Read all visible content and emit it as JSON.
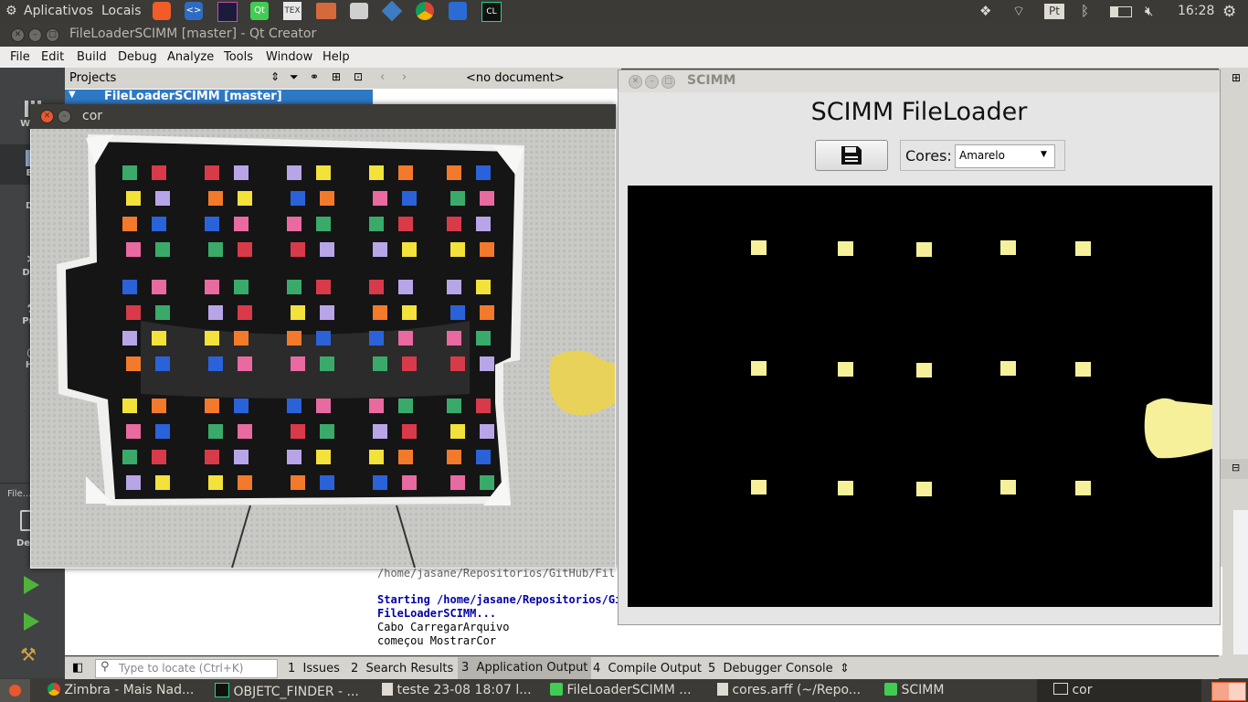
{
  "top_panel": {
    "apps_label": "Aplicativos",
    "places_label": "Locais",
    "keyboard_layout": "Pt",
    "clock": "16:28",
    "launchers": [
      "brave-icon",
      "code-editor-icon",
      "intellij-icon",
      "qt-icon",
      "tex-icon",
      "files-icon",
      "camera-icon",
      "virtualbox-icon",
      "chrome-icon",
      "network-tool-icon",
      "clion-icon"
    ]
  },
  "qt_window": {
    "title": "FileLoaderSCIMM [master] - Qt Creator",
    "menus": [
      "File",
      "Edit",
      "Build",
      "Debug",
      "Analyze",
      "Tools",
      "Window",
      "Help"
    ],
    "projects_label": "Projects",
    "project_root": "FileLoaderSCIMM [master]",
    "no_document": "<no document>",
    "modes": [
      "Welc",
      "Ed",
      "De",
      "Deb",
      "Proj",
      "He"
    ],
    "file_label": "File...",
    "deb_label": "De",
    "locate_placeholder": "Type to locate (Ctrl+K)",
    "output_tabs": [
      {
        "num": "1",
        "label": "Issues"
      },
      {
        "num": "2",
        "label": "Search Results"
      },
      {
        "num": "3",
        "label": "Application Output"
      },
      {
        "num": "4",
        "label": "Compile Output"
      },
      {
        "num": "5",
        "label": "Debugger Console"
      }
    ],
    "output_lines": [
      {
        "text": "/home/jasane/Repositorios/GitHub/Fil",
        "style": "path"
      },
      {
        "text": "",
        "style": "plain"
      },
      {
        "text": "Starting /home/jasane/Repositorios/Gi",
        "style": "bold"
      },
      {
        "text": "FileLoaderSCIMM...",
        "style": "bold"
      },
      {
        "text": "Cabo CarregarArquivo",
        "style": "plain"
      },
      {
        "text": "começou MostrarCor",
        "style": "plain"
      }
    ]
  },
  "cor_window": {
    "title": "cor"
  },
  "scimm_window": {
    "title": "SCIMM",
    "heading": "SCIMM FileLoader",
    "cores_label": "Cores:",
    "cores_selected": "Amarelo",
    "mask_color": "#f6f09a"
  },
  "taskbar": [
    {
      "icon": "chrome-icon",
      "label": "Zimbra - Mais Nad..."
    },
    {
      "icon": "clion-icon",
      "label": "OBJETC_FINDER - ..."
    },
    {
      "icon": "text-editor-icon",
      "label": "teste 23-08 18:07 l..."
    },
    {
      "icon": "qt-icon",
      "label": "FileLoaderSCIMM ..."
    },
    {
      "icon": "text-editor-icon",
      "label": "cores.arff (~/Repo..."
    },
    {
      "icon": "qt-icon",
      "label": "SCIMM"
    },
    {
      "icon": "window-icon",
      "label": "cor"
    }
  ]
}
